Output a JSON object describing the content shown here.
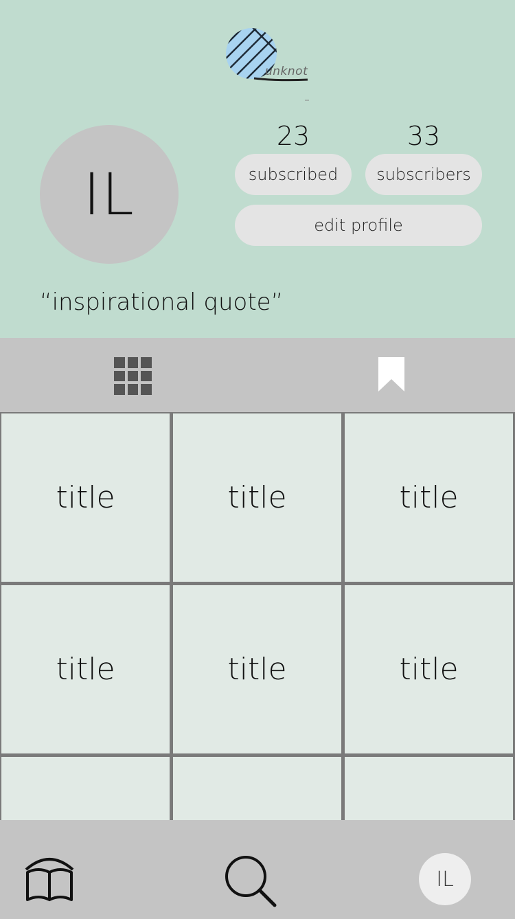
{
  "brand": {
    "logo_text": "unknot",
    "logo_color": "#a8d3f0"
  },
  "profile": {
    "initials": "IL",
    "quote": "“inspirational quote”",
    "subscribed_count": "23",
    "subscribed_label": "subscribed",
    "subscribers_count": "33",
    "subscribers_label": "subscribers",
    "edit_label": "edit profile"
  },
  "tabs": [
    {
      "name": "grid",
      "icon": "grid-icon"
    },
    {
      "name": "saved",
      "icon": "bookmark-icon"
    }
  ],
  "posts": [
    {
      "title": "title"
    },
    {
      "title": "title"
    },
    {
      "title": "title"
    },
    {
      "title": "title"
    },
    {
      "title": "title"
    },
    {
      "title": "title"
    },
    {
      "title": ""
    },
    {
      "title": ""
    },
    {
      "title": ""
    }
  ],
  "nav": {
    "items": [
      {
        "name": "library",
        "icon": "book-icon"
      },
      {
        "name": "search",
        "icon": "search-icon"
      },
      {
        "name": "profile",
        "initials": "IL"
      }
    ]
  },
  "colors": {
    "header_bg": "#c0dccf",
    "tile_bg": "#e1eae5",
    "bar_bg": "#c4c4c4",
    "pill_bg": "#e4e4e4"
  }
}
